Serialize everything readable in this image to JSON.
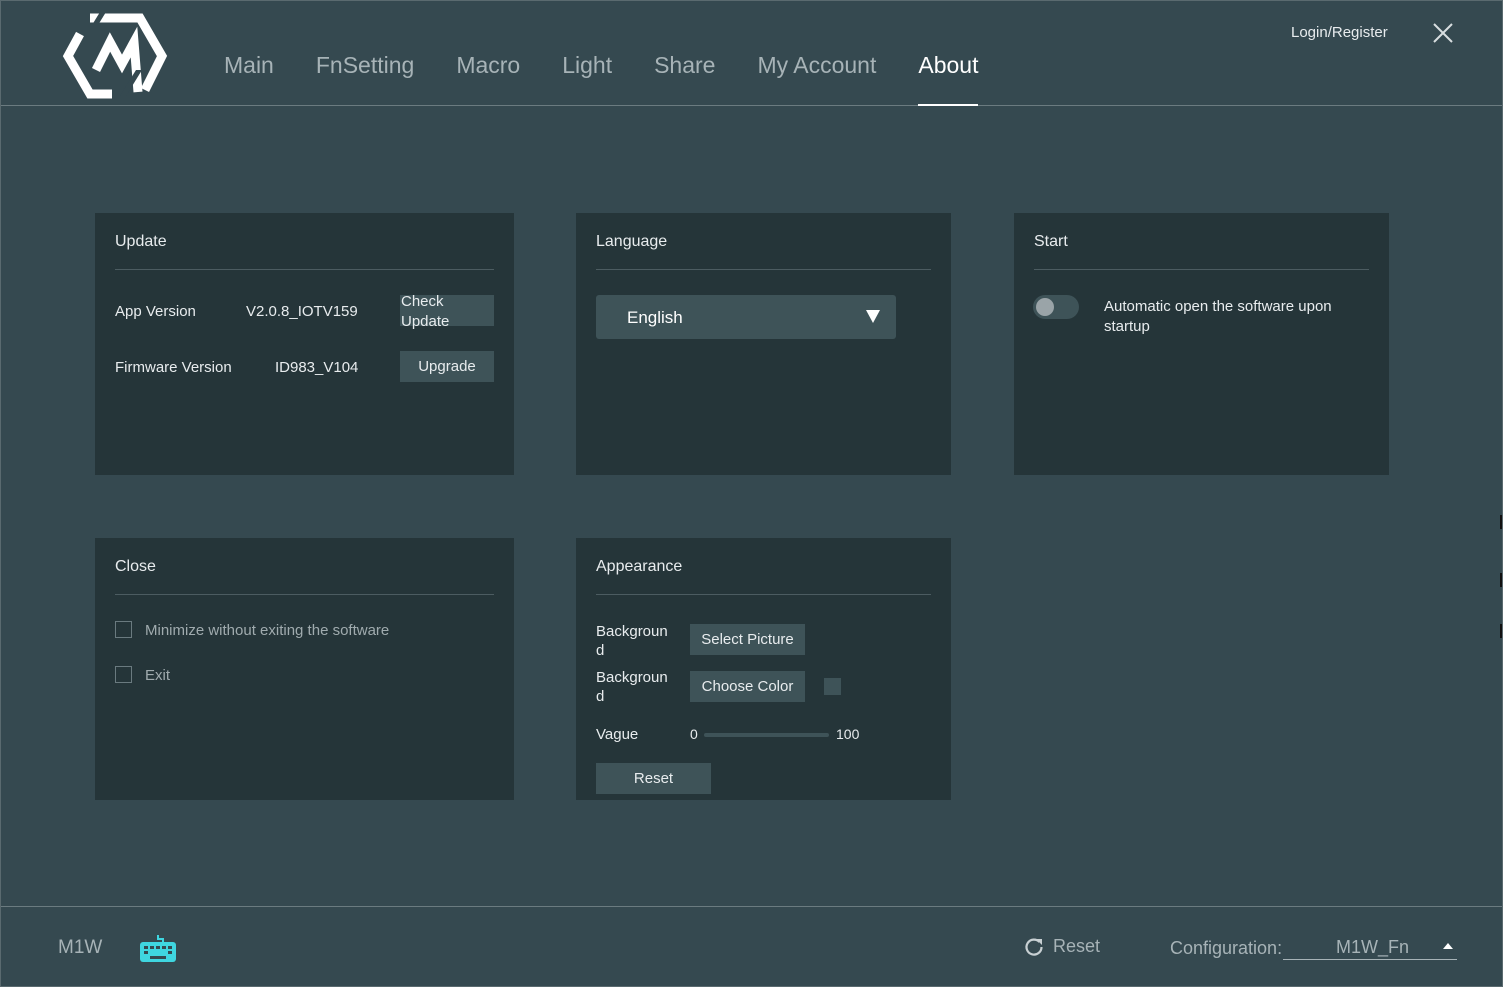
{
  "header": {
    "logo_icon": "brand-hexagon-logo-icon",
    "tabs": [
      "Main",
      "FnSetting",
      "Macro",
      "Light",
      "Share",
      "My Account",
      "About"
    ],
    "active_tab": "About",
    "login": "Login/Register",
    "close_icon": "close-icon"
  },
  "update": {
    "title": "Update",
    "app_version_label": "App Version",
    "app_version_value": "V2.0.8_IOTV159",
    "check_update_line1": "Check",
    "check_update_line2": "Update",
    "firmware_label": "Firmware Version",
    "firmware_value": "ID983_V104",
    "upgrade": "Upgrade"
  },
  "language": {
    "title": "Language",
    "selected": "English",
    "caret_icon": "caret-down-icon"
  },
  "start": {
    "title": "Start",
    "auto_open_line1": "Automatic open the software upon",
    "auto_open_line2": "startup",
    "auto_open_enabled": false
  },
  "close_panel": {
    "title": "Close",
    "minimize_label": "Minimize without exiting the software",
    "minimize_checked": false,
    "exit_label": "Exit",
    "exit_checked": false
  },
  "appearance": {
    "title": "Appearance",
    "bg_picture_label_line1": "Backgroun",
    "bg_picture_label_line2": "d",
    "select_picture": "Select Picture",
    "bg_color_label_line1": "Backgroun",
    "bg_color_label_line2": "d",
    "choose_color": "Choose Color",
    "swatch_color": "#3e5358",
    "vague_label": "Vague",
    "vague_min": "0",
    "vague_max": "100",
    "vague_value": 0,
    "reset": "Reset"
  },
  "footer": {
    "device": "M1W",
    "keyboard_icon": "keyboard-icon",
    "reset_icon": "refresh-icon",
    "reset": "Reset",
    "config_label": "Configuration:",
    "config_value": "M1W_Fn",
    "config_caret_icon": "caret-up-icon"
  },
  "colors": {
    "background": "#354950",
    "panel": "#253539",
    "button": "#3e5358",
    "accent": "#3fd6e0",
    "inactive_text": "#a7b3b7"
  }
}
